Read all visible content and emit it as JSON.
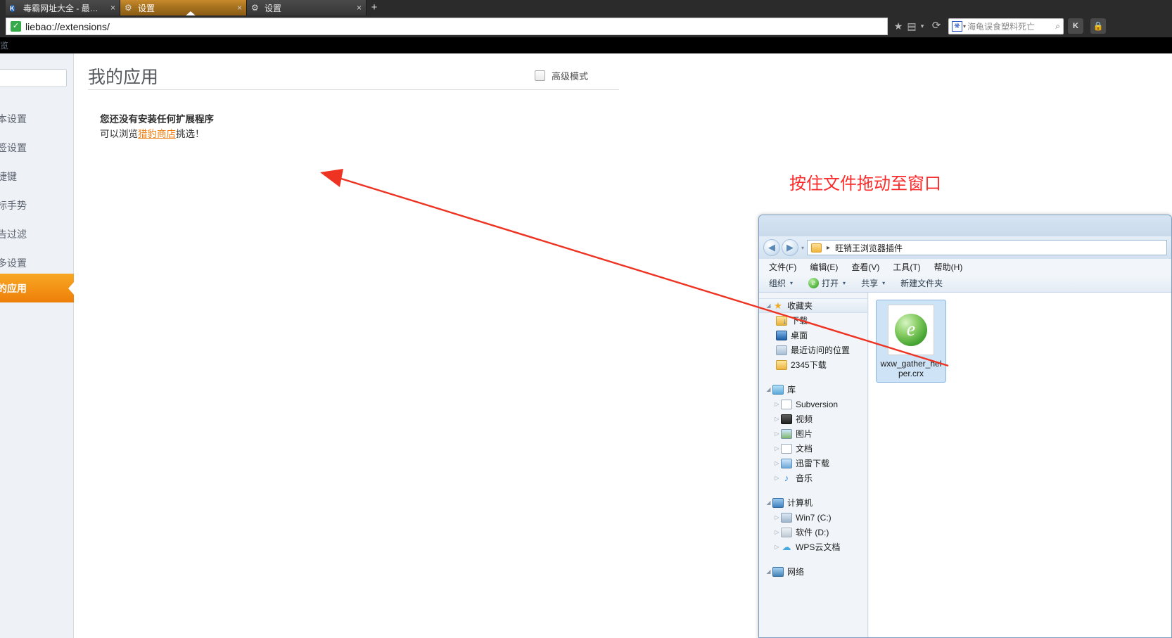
{
  "browser": {
    "tabs": [
      {
        "title": "毒霸网址大全 - 最安...",
        "favicon": "k-logo-icon",
        "active": false,
        "close_label": "×"
      },
      {
        "title": "设置",
        "favicon": "gear-icon",
        "active": true,
        "close_label": "×"
      },
      {
        "title": "设置",
        "favicon": "gear-icon",
        "active": false,
        "close_label": "×"
      }
    ],
    "new_tab_label": "+",
    "address": {
      "url": "liebao://extensions/",
      "secure_glyph": "✓"
    },
    "nav_icons": {
      "bookmark_star": "★",
      "qrcode": "▤",
      "caret": "▾",
      "reload": "⟳"
    },
    "search": {
      "engine_icon": "paw-icon",
      "engine_caret": "▾",
      "query": "海龟误食塑料死亡",
      "go_glyph": "🔍"
    },
    "extension_buttons": [
      {
        "label": "K",
        "name": "kingsoft-button"
      },
      {
        "label": "🔒",
        "name": "lock-button"
      }
    ]
  },
  "black_strip": {
    "text": "览"
  },
  "settings": {
    "sidebar": {
      "search_placeholder": "",
      "items": [
        {
          "label": "基本设置",
          "active": false
        },
        {
          "label": "标签设置",
          "active": false
        },
        {
          "label": "快捷键",
          "active": false
        },
        {
          "label": "鼠标手势",
          "active": false
        },
        {
          "label": "广告过滤",
          "active": false
        },
        {
          "label": "更多设置",
          "active": false
        },
        {
          "label": "我的应用",
          "active": true
        }
      ]
    },
    "page_title": "我的应用",
    "advanced_mode": {
      "label": "高级模式",
      "checked": false
    },
    "empty_state": {
      "title": "您还没有安装任何扩展程序",
      "prefix": "可以浏览",
      "link": "猎豹商店",
      "suffix": "挑选！"
    }
  },
  "annotation": {
    "text": "按住文件拖动至窗口",
    "color": "#fb2b2b",
    "arrow_color": "#ee3322"
  },
  "explorer": {
    "address": {
      "back_glyph": "◀",
      "forward_glyph": "▶",
      "history_caret": "▾",
      "crumb_sep": "▸",
      "breadcrumb": "旺销王浏览器插件"
    },
    "menu": [
      "文件(F)",
      "编辑(E)",
      "查看(V)",
      "工具(T)",
      "帮助(H)"
    ],
    "toolbar": [
      {
        "label": "组织",
        "caret": "▾",
        "icon": "none"
      },
      {
        "label": "打开",
        "caret": "▾",
        "icon": "ie-browser-icon"
      },
      {
        "label": "共享",
        "caret": "▾",
        "icon": "none"
      },
      {
        "label": "新建文件夹",
        "caret": "",
        "icon": "none"
      }
    ],
    "tree": [
      {
        "label": "收藏夹",
        "level": 0,
        "twisty": "◢",
        "icon": "star-icon",
        "selected": true
      },
      {
        "label": "下载",
        "level": 1,
        "twisty": "",
        "icon": "download-folder-icon",
        "selected": false
      },
      {
        "label": "桌面",
        "level": 1,
        "twisty": "",
        "icon": "desktop-icon",
        "selected": false
      },
      {
        "label": "最近访问的位置",
        "level": 1,
        "twisty": "",
        "icon": "recent-places-icon",
        "selected": false
      },
      {
        "label": "2345下载",
        "level": 1,
        "twisty": "",
        "icon": "folder-icon",
        "selected": false
      },
      {
        "label": "库",
        "level": 0,
        "twisty": "◢",
        "icon": "library-icon",
        "selected": false,
        "gap_before": true
      },
      {
        "label": "Subversion",
        "level": 1,
        "twisty": "▷",
        "icon": "document-icon",
        "selected": false
      },
      {
        "label": "视频",
        "level": 1,
        "twisty": "▷",
        "icon": "video-icon",
        "selected": false
      },
      {
        "label": "图片",
        "level": 1,
        "twisty": "▷",
        "icon": "picture-icon",
        "selected": false
      },
      {
        "label": "文档",
        "level": 1,
        "twisty": "▷",
        "icon": "document-icon",
        "selected": false
      },
      {
        "label": "迅雷下载",
        "level": 1,
        "twisty": "▷",
        "icon": "xunlei-icon",
        "selected": false
      },
      {
        "label": "音乐",
        "level": 1,
        "twisty": "▷",
        "icon": "music-icon",
        "selected": false
      },
      {
        "label": "计算机",
        "level": 0,
        "twisty": "◢",
        "icon": "computer-icon",
        "selected": false,
        "gap_before": true
      },
      {
        "label": "Win7 (C:)",
        "level": 1,
        "twisty": "▷",
        "icon": "drive-c-icon",
        "selected": false
      },
      {
        "label": "软件 (D:)",
        "level": 1,
        "twisty": "▷",
        "icon": "drive-d-icon",
        "selected": false
      },
      {
        "label": "WPS云文档",
        "level": 1,
        "twisty": "▷",
        "icon": "cloud-icon",
        "selected": false
      },
      {
        "label": "网络",
        "level": 0,
        "twisty": "◢",
        "icon": "network-icon",
        "selected": false,
        "gap_before": true
      }
    ],
    "files": [
      {
        "name": "wxw_gather_helper.crx",
        "icon": "crx-extension-icon",
        "glyph": "e",
        "selected": true
      }
    ]
  }
}
